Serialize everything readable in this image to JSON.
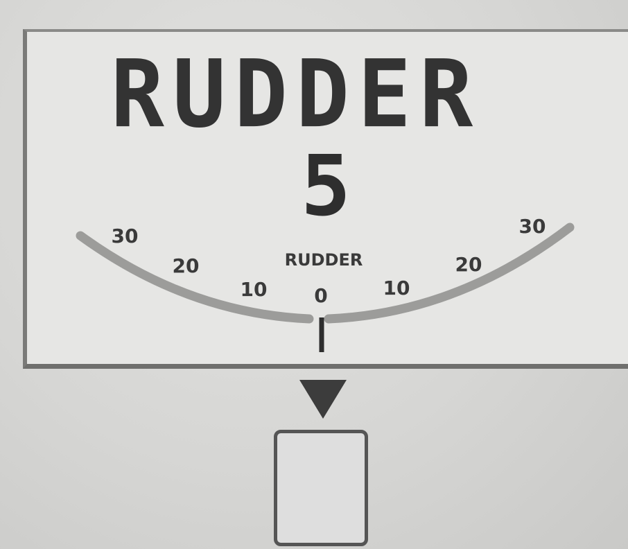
{
  "gauge": {
    "title": "RUDDER",
    "readout": "5",
    "scale_label": "RUDDER",
    "tick_labels": [
      "30",
      "20",
      "10",
      "0",
      "10",
      "20",
      "30"
    ],
    "current_value": 0
  }
}
